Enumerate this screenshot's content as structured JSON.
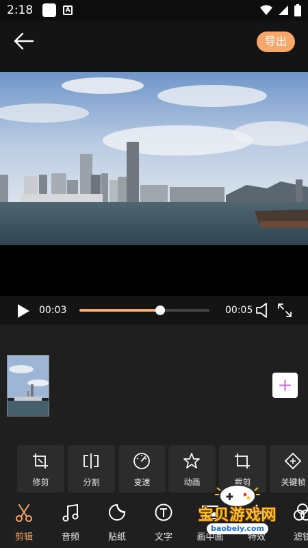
{
  "status_bar": {
    "time": "2:18",
    "a_badge": "A"
  },
  "top_bar": {
    "export_label": "导出"
  },
  "player": {
    "current_time": "00:03",
    "total_time": "00:05",
    "progress": 0.62
  },
  "tools": [
    {
      "label": "修剪",
      "icon": "trim-icon"
    },
    {
      "label": "分割",
      "icon": "split-icon"
    },
    {
      "label": "变速",
      "icon": "speed-icon"
    },
    {
      "label": "动画",
      "icon": "animation-icon"
    },
    {
      "label": "裁剪",
      "icon": "crop-icon"
    },
    {
      "label": "关键帧",
      "icon": "keyframe-icon"
    }
  ],
  "nav": [
    {
      "label": "剪辑",
      "icon": "scissors-icon",
      "active": true
    },
    {
      "label": "音频",
      "icon": "music-note-icon"
    },
    {
      "label": "贴纸",
      "icon": "sticker-icon"
    },
    {
      "label": "文字",
      "icon": "text-icon"
    },
    {
      "label": "画中画",
      "icon": "pip-icon"
    },
    {
      "label": "特效",
      "icon": "effects-icon"
    },
    {
      "label": "滤镜",
      "icon": "filter-icon"
    }
  ],
  "watermark": {
    "text": "宝贝游戏网",
    "url": "baobeiy.com"
  },
  "colors": {
    "accent": "#f6a76a",
    "panel": "#1f1f1f",
    "tool_bg": "#2c2c2c"
  }
}
